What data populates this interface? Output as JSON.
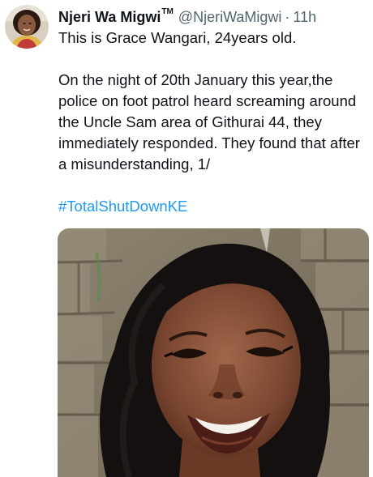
{
  "tweet": {
    "author": {
      "display_name": "Njeri Wa Migwi",
      "trademark": "TM",
      "handle": "@NjeriWaMigwi",
      "separator": "·",
      "time": "11h",
      "avatar": "profile-photo"
    },
    "text": {
      "line1": "This is Grace Wangari, 24years old.",
      "para2": "On the night of 20th January this year,the police on foot patrol heard screaming around the Uncle Sam area of  Githurai 44, they immediately responded. They found that after a misunderstanding, 1/",
      "hashtag": "#TotalShutDownKE"
    },
    "media": {
      "kind": "photo",
      "subject": "smiling-woman-portrait"
    },
    "colors": {
      "text": "#0f1419",
      "secondary": "#536471",
      "link": "#1d9bf0"
    }
  }
}
